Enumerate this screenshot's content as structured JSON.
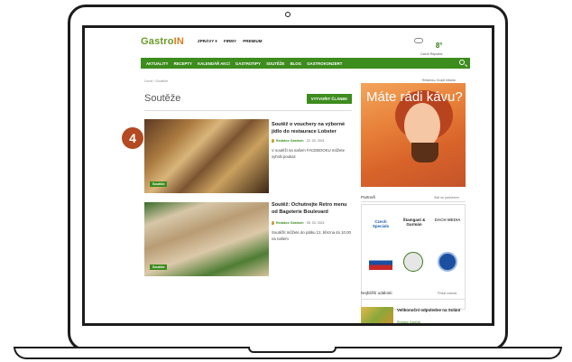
{
  "site": {
    "logo_main": "Gastro",
    "logo_accent": "IN",
    "top_nav": [
      "ZPRÁVY ▾",
      "FIRMY",
      "PREMIUM"
    ],
    "weather_temp": "8°",
    "weather_location": "Czech Republic",
    "nav_items": [
      "AKTUALITY",
      "RECEPTY",
      "KALENDÁŘ AKCÍ",
      "GASTROTIPY",
      "SOUTĚŽE",
      "BLOG",
      "GASTROKONZERT"
    ],
    "breadcrumb": "Úvod  ›  Soutěže",
    "page_title": "Soutěže",
    "new_article_button": "VYTVOŘIT ČLÁNEK",
    "step_badge": "4",
    "articles": [
      {
        "tag": "Soutěže",
        "title": "Soutěž o vouchery na výborné jídlo do restaurace Lobster",
        "author": "Redakce Gastroln",
        "date": "22. 03. 2021",
        "excerpt": "V soutěži na našem FACEBOOKU můžete vyhrát poukaz"
      },
      {
        "tag": "Soutěže",
        "title": "Soutěž: Ochutnejte Retro menu od Bageterie Boulevard",
        "author": "Redakce Gastroln",
        "date": "05. 03. 2021",
        "excerpt": "Soutěžit můžete do pátku 12. března do 10.00 na našem"
      }
    ],
    "sidebar": {
      "ad_label": "Reklama ▸ Koupit reklamu",
      "ad_text": "Máte rádi kávu?",
      "partners_title": "Partneři",
      "partners_link": "Stát se partnerem",
      "partner_logos": [
        "Czech Specials",
        "Štamgast & Gurmán",
        "DACH MEDIA"
      ],
      "events_title": "Nejbližší události",
      "events_link": "Přidat událost",
      "event_title": "Velikonoční odpoledne na Solání",
      "event_meta": "Redakce Gastroln"
    }
  }
}
